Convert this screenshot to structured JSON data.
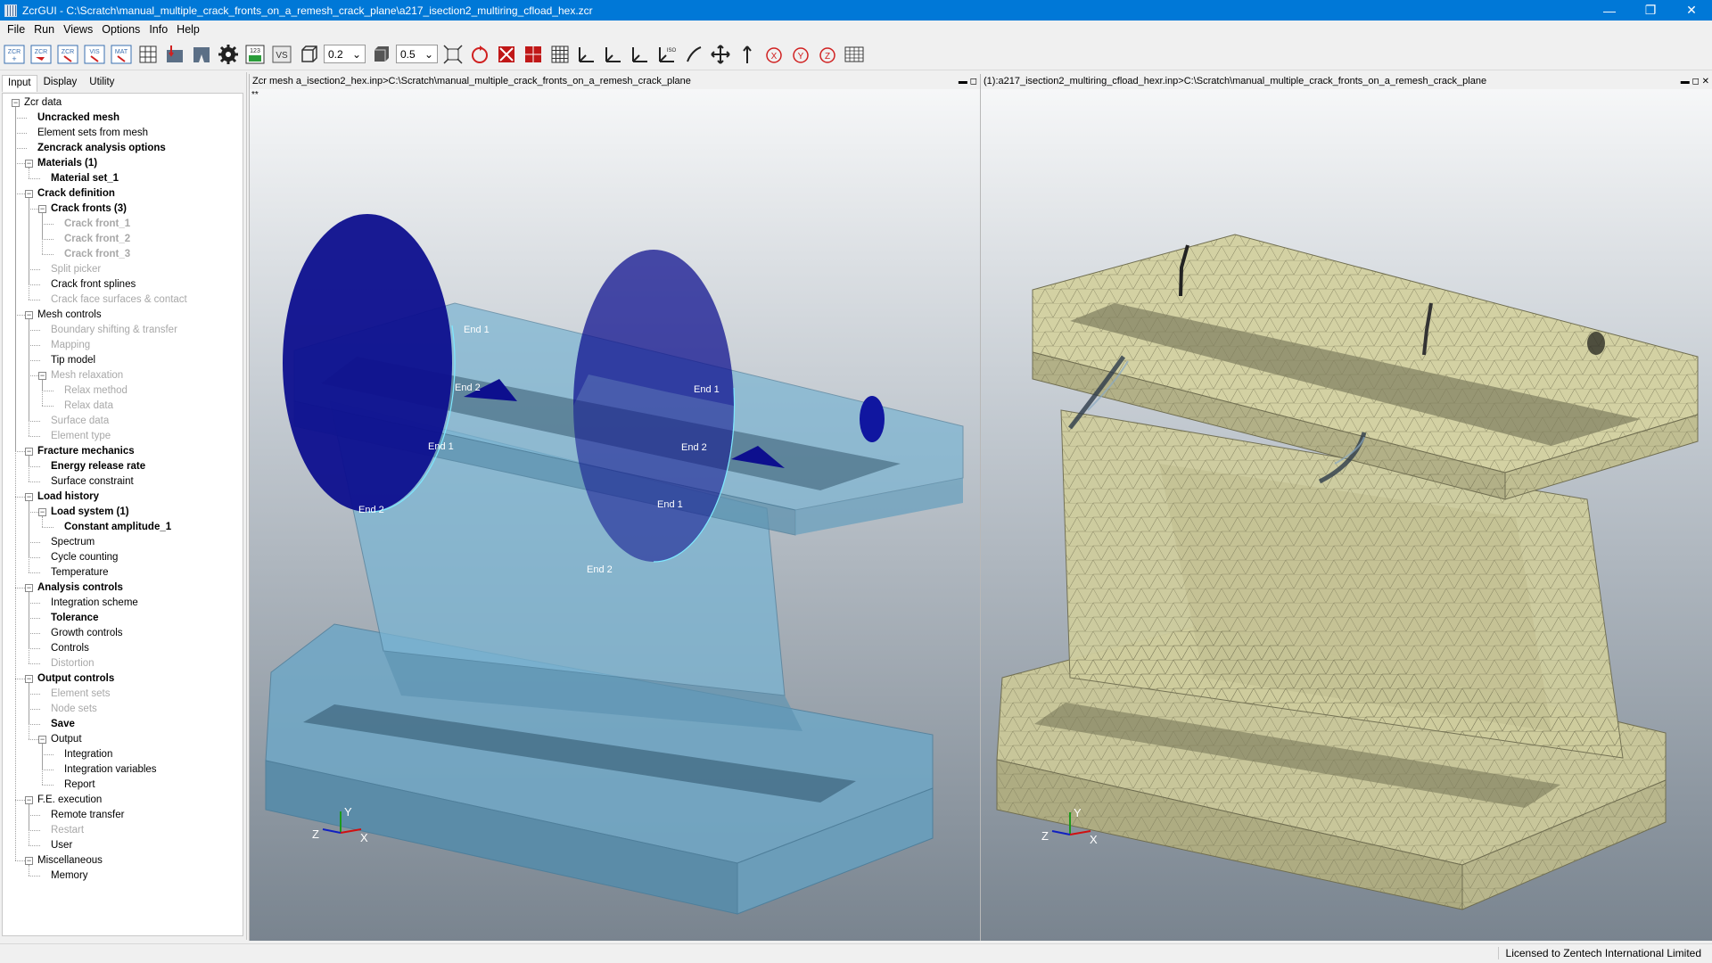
{
  "window": {
    "title": "ZcrGUI - C:\\Scratch\\manual_multiple_crack_fronts_on_a_remesh_crack_plane\\a217_isection2_multiring_cfload_hex.zcr",
    "min": "—",
    "max": "❐",
    "close": "✕"
  },
  "menu": [
    "File",
    "Run",
    "Views",
    "Options",
    "Info",
    "Help"
  ],
  "toolbar": {
    "icons": [
      {
        "label": "ZCR",
        "icon": "new-zcr-icon"
      },
      {
        "label": "ZCR",
        "icon": "open-zcr-icon"
      },
      {
        "label": "ZCR",
        "icon": "save-zcr-icon"
      },
      {
        "label": "VIS",
        "icon": "vis-icon"
      },
      {
        "label": "MAT",
        "icon": "mat-icon"
      },
      {
        "label": "",
        "icon": "mesh-grid-icon"
      },
      {
        "label": "",
        "icon": "crack-insert-icon"
      },
      {
        "label": "",
        "icon": "crack-front-icon"
      },
      {
        "label": "",
        "icon": "settings-gear-icon"
      },
      {
        "label": "123",
        "icon": "numbering-icon"
      },
      {
        "label": "VS",
        "icon": "vs-icon"
      }
    ],
    "opacity1": "0.2",
    "opacity2": "0.5",
    "viewicons": [
      "fit-view-icon",
      "rotate-view-icon",
      "red-mesh-off-icon",
      "red-mesh-icon",
      "grid-icon",
      "axes-xy-icon",
      "axes-zy-icon",
      "axes-zx-icon",
      "iso-view-icon",
      "line-icon",
      "pan-icon",
      "up-arrow-icon",
      "rotate-x-icon",
      "rotate-y-icon",
      "rotate-z-icon",
      "layout-icon"
    ]
  },
  "tabs": [
    "Input",
    "Display",
    "Utility"
  ],
  "tree": [
    {
      "label": "Zcr data",
      "level": 0,
      "style": "normal",
      "expander": "−"
    },
    {
      "label": "Uncracked mesh",
      "level": 1,
      "style": "bold",
      "expander": ""
    },
    {
      "label": "Element sets from mesh",
      "level": 1,
      "style": "normal",
      "expander": ""
    },
    {
      "label": "Zencrack analysis options",
      "level": 1,
      "style": "bold",
      "expander": ""
    },
    {
      "label": "Materials (1)",
      "level": 1,
      "style": "bold",
      "expander": "−"
    },
    {
      "label": "Material set_1",
      "level": 2,
      "style": "bold",
      "expander": ""
    },
    {
      "label": "Crack definition",
      "level": 1,
      "style": "bold",
      "expander": "−"
    },
    {
      "label": "Crack fronts (3)",
      "level": 2,
      "style": "bold",
      "expander": "−"
    },
    {
      "label": "Crack front_1",
      "level": 3,
      "style": "disabled-bold",
      "expander": ""
    },
    {
      "label": "Crack front_2",
      "level": 3,
      "style": "disabled-bold",
      "expander": ""
    },
    {
      "label": "Crack front_3",
      "level": 3,
      "style": "disabled-bold",
      "expander": ""
    },
    {
      "label": "Split picker",
      "level": 2,
      "style": "disabled",
      "expander": ""
    },
    {
      "label": "Crack front splines",
      "level": 2,
      "style": "normal",
      "expander": ""
    },
    {
      "label": "Crack face surfaces & contact",
      "level": 2,
      "style": "disabled",
      "expander": ""
    },
    {
      "label": "Mesh controls",
      "level": 1,
      "style": "normal",
      "expander": "−"
    },
    {
      "label": "Boundary shifting & transfer",
      "level": 2,
      "style": "disabled",
      "expander": ""
    },
    {
      "label": "Mapping",
      "level": 2,
      "style": "disabled",
      "expander": ""
    },
    {
      "label": "Tip model",
      "level": 2,
      "style": "normal",
      "expander": ""
    },
    {
      "label": "Mesh relaxation",
      "level": 2,
      "style": "disabled",
      "expander": "−"
    },
    {
      "label": "Relax method",
      "level": 3,
      "style": "disabled",
      "expander": ""
    },
    {
      "label": "Relax data",
      "level": 3,
      "style": "disabled",
      "expander": ""
    },
    {
      "label": "Surface data",
      "level": 2,
      "style": "disabled",
      "expander": ""
    },
    {
      "label": "Element type",
      "level": 2,
      "style": "disabled",
      "expander": ""
    },
    {
      "label": "Fracture mechanics",
      "level": 1,
      "style": "bold",
      "expander": "−"
    },
    {
      "label": "Energy release rate",
      "level": 2,
      "style": "bold",
      "expander": ""
    },
    {
      "label": "Surface constraint",
      "level": 2,
      "style": "normal",
      "expander": ""
    },
    {
      "label": "Load history",
      "level": 1,
      "style": "bold",
      "expander": "−"
    },
    {
      "label": "Load system (1)",
      "level": 2,
      "style": "bold",
      "expander": "−"
    },
    {
      "label": "Constant amplitude_1",
      "level": 3,
      "style": "bold",
      "expander": ""
    },
    {
      "label": "Spectrum",
      "level": 2,
      "style": "normal",
      "expander": ""
    },
    {
      "label": "Cycle counting",
      "level": 2,
      "style": "normal",
      "expander": ""
    },
    {
      "label": "Temperature",
      "level": 2,
      "style": "normal",
      "expander": ""
    },
    {
      "label": "Analysis controls",
      "level": 1,
      "style": "bold",
      "expander": "−"
    },
    {
      "label": "Integration scheme",
      "level": 2,
      "style": "normal",
      "expander": ""
    },
    {
      "label": "Tolerance",
      "level": 2,
      "style": "bold",
      "expander": ""
    },
    {
      "label": "Growth controls",
      "level": 2,
      "style": "normal",
      "expander": ""
    },
    {
      "label": "Controls",
      "level": 2,
      "style": "normal",
      "expander": ""
    },
    {
      "label": "Distortion",
      "level": 2,
      "style": "disabled",
      "expander": ""
    },
    {
      "label": "Output controls",
      "level": 1,
      "style": "bold",
      "expander": "−"
    },
    {
      "label": "Element sets",
      "level": 2,
      "style": "disabled",
      "expander": ""
    },
    {
      "label": "Node sets",
      "level": 2,
      "style": "disabled",
      "expander": ""
    },
    {
      "label": "Save",
      "level": 2,
      "style": "bold",
      "expander": ""
    },
    {
      "label": "Output",
      "level": 2,
      "style": "normal",
      "expander": "−"
    },
    {
      "label": "Integration",
      "level": 3,
      "style": "normal",
      "expander": ""
    },
    {
      "label": "Integration variables",
      "level": 3,
      "style": "normal",
      "expander": ""
    },
    {
      "label": "Report",
      "level": 3,
      "style": "normal",
      "expander": ""
    },
    {
      "label": "F.E. execution",
      "level": 1,
      "style": "normal",
      "expander": "−"
    },
    {
      "label": "Remote transfer",
      "level": 2,
      "style": "normal",
      "expander": ""
    },
    {
      "label": "Restart",
      "level": 2,
      "style": "disabled",
      "expander": ""
    },
    {
      "label": "User",
      "level": 2,
      "style": "normal",
      "expander": ""
    },
    {
      "label": "Miscellaneous",
      "level": 1,
      "style": "normal",
      "expander": "−"
    },
    {
      "label": "Memory",
      "level": 2,
      "style": "normal",
      "expander": ""
    }
  ],
  "viewportLeft": {
    "title": "Zcr mesh a_isection2_hex.inp>C:\\Scratch\\manual_multiple_crack_fronts_on_a_remesh_crack_plane",
    "marker": "**",
    "controls": "▬ ◻",
    "labels": [
      "End 1",
      "End 2",
      "End 1",
      "End 2",
      "End 1",
      "End 2",
      "End 1",
      "End 2"
    ],
    "axes": {
      "x": "X",
      "y": "Y",
      "z": "Z"
    }
  },
  "viewportRight": {
    "title": "(1):a217_isection2_multiring_cfload_hexr.inp>C:\\Scratch\\manual_multiple_crack_fronts_on_a_remesh_crack_plane",
    "controls": "▬ ◻ ✕",
    "axes": {
      "x": "X",
      "y": "Y",
      "z": "Z"
    }
  },
  "status": {
    "license": "Licensed to Zentech International Limited"
  },
  "colors": {
    "titlebar": "#0078d7",
    "crackDisc": "#0d0f8e",
    "body": "#6fa7c6",
    "mesh": "#c8c69a"
  }
}
